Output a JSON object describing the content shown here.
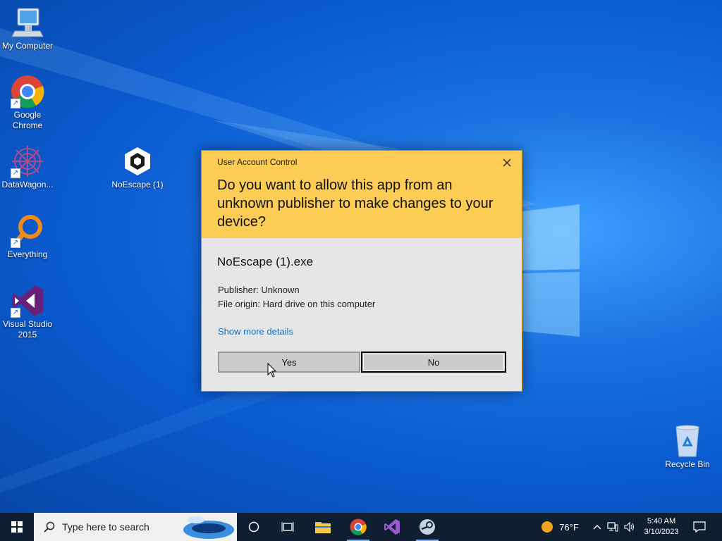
{
  "desktop": {
    "icons": [
      {
        "label": "My Computer",
        "icon": "computer-icon"
      },
      {
        "label": "Google Chrome",
        "icon": "chrome-icon"
      },
      {
        "label": "DataWagon...",
        "icon": "datawagon-icon"
      },
      {
        "label": "NoEscape (1)",
        "icon": "unity-icon"
      },
      {
        "label": "Everything",
        "icon": "everything-search-icon"
      },
      {
        "label": "Visual Studio 2015",
        "icon": "visual-studio-icon"
      },
      {
        "label": "Recycle Bin",
        "icon": "recycle-bin-icon"
      }
    ]
  },
  "dialog": {
    "title": "User Account Control",
    "question": "Do you want to allow this app from an unknown publisher to make changes to your device?",
    "app_name": "NoEscape (1).exe",
    "publisher": "Publisher: Unknown",
    "origin": "File origin: Hard drive on this computer",
    "more_details": "Show more details",
    "yes_label": "Yes",
    "no_label": "No",
    "header_color": "#fdcc55"
  },
  "taskbar": {
    "search_placeholder": "Type here to search",
    "apps": [
      "cortana-icon",
      "task-view-icon",
      "file-explorer-icon",
      "chrome-icon",
      "visual-studio-icon",
      "steam-icon"
    ],
    "weather": "76°F",
    "time": "5:40 AM",
    "date": "3/10/2023"
  }
}
